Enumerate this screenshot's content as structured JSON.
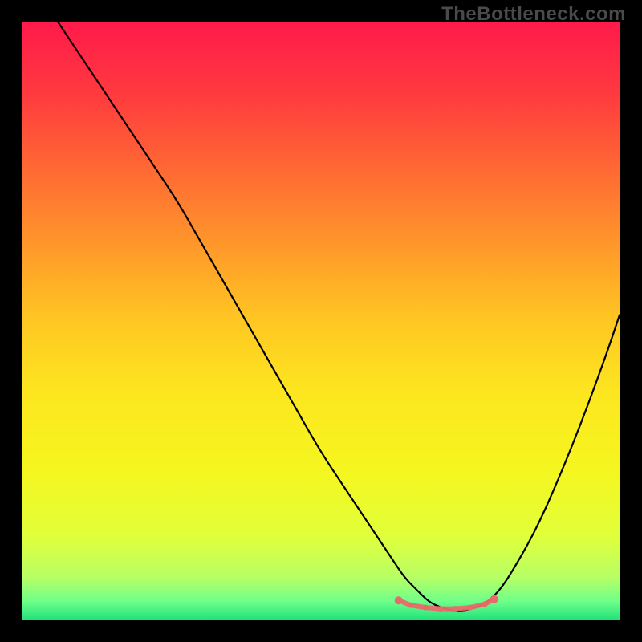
{
  "watermark": "TheBottleneck.com",
  "chart_data": {
    "type": "line",
    "title": "",
    "xlabel": "",
    "ylabel": "",
    "xlim": [
      0,
      100
    ],
    "ylim": [
      0,
      100
    ],
    "grid": false,
    "x": [
      6,
      10,
      14,
      18,
      22,
      26,
      30,
      34,
      38,
      42,
      46,
      50,
      54,
      58,
      62,
      64,
      66,
      68,
      70,
      72,
      74,
      76,
      78,
      80,
      82,
      86,
      90,
      94,
      98,
      100
    ],
    "values": [
      100,
      94,
      88,
      82,
      76,
      70,
      63,
      56,
      49,
      42,
      35,
      28,
      22,
      16,
      10,
      7,
      5,
      3,
      2,
      1.5,
      1.5,
      2,
      3,
      5,
      8,
      15,
      24,
      34,
      45,
      51
    ],
    "background": {
      "type": "vertical-gradient",
      "stops": [
        {
          "offset": 0.0,
          "color": "#ff1a4a"
        },
        {
          "offset": 0.12,
          "color": "#ff3a3f"
        },
        {
          "offset": 0.25,
          "color": "#ff6a33"
        },
        {
          "offset": 0.38,
          "color": "#ff9a2a"
        },
        {
          "offset": 0.5,
          "color": "#ffc722"
        },
        {
          "offset": 0.62,
          "color": "#fde61f"
        },
        {
          "offset": 0.75,
          "color": "#f5f61f"
        },
        {
          "offset": 0.86,
          "color": "#e1ff3a"
        },
        {
          "offset": 0.93,
          "color": "#b6ff66"
        },
        {
          "offset": 0.97,
          "color": "#6dff8a"
        },
        {
          "offset": 1.0,
          "color": "#23e27a"
        }
      ]
    },
    "markers": {
      "color": "#e96a6a",
      "points": [
        {
          "x": 63,
          "y": 3.2
        },
        {
          "x": 65,
          "y": 2.4
        },
        {
          "x": 67.5,
          "y": 2.0
        },
        {
          "x": 70,
          "y": 1.8
        },
        {
          "x": 72.5,
          "y": 1.8
        },
        {
          "x": 75,
          "y": 2.0
        },
        {
          "x": 77.5,
          "y": 2.6
        },
        {
          "x": 79,
          "y": 3.4
        }
      ]
    }
  }
}
